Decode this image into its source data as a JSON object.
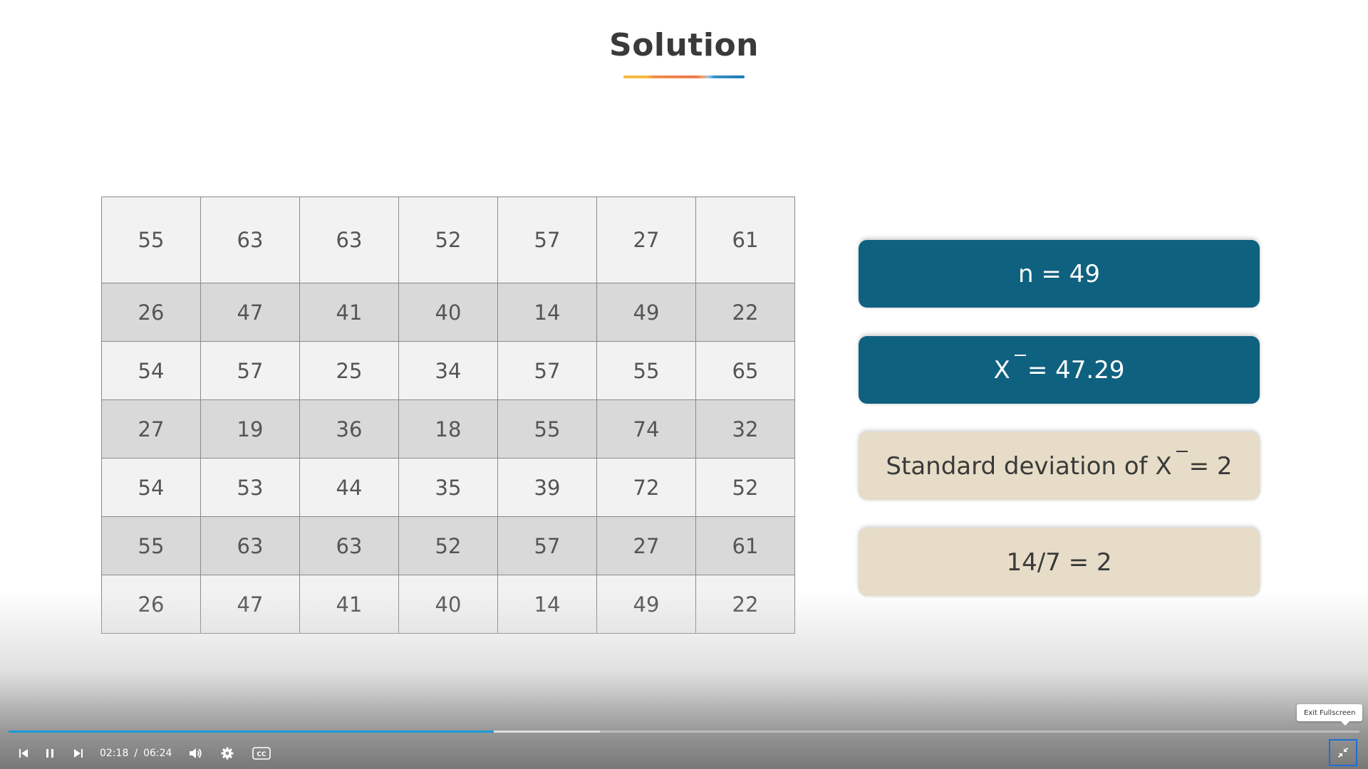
{
  "slide": {
    "title": "Solution",
    "table": [
      [
        "55",
        "63",
        "63",
        "52",
        "57",
        "27",
        "61"
      ],
      [
        "26",
        "47",
        "41",
        "40",
        "14",
        "49",
        "22"
      ],
      [
        "54",
        "57",
        "25",
        "34",
        "57",
        "55",
        "65"
      ],
      [
        "27",
        "19",
        "36",
        "18",
        "55",
        "74",
        "32"
      ],
      [
        "54",
        "53",
        "44",
        "35",
        "39",
        "72",
        "52"
      ],
      [
        "55",
        "63",
        "63",
        "52",
        "57",
        "27",
        "61"
      ],
      [
        "26",
        "47",
        "41",
        "40",
        "14",
        "49",
        "22"
      ]
    ],
    "boxes": {
      "n": "n = 49",
      "mean_symbol": "X",
      "mean_rest": "= 47.29",
      "sd_prefix": "Standard deviation of X",
      "sd_rest": "= 2",
      "ratio": "14/7 = 2"
    },
    "colors": {
      "blue_box": "#0f6180",
      "beige_box": "#e6dcc7",
      "row_light": "#f2f2f2",
      "row_dark": "#d9d9d9"
    }
  },
  "player": {
    "current_time": "02:18",
    "separator": "/",
    "duration": "06:24",
    "progress_played_fraction": 0.359,
    "progress_buffered_fraction": 0.4375,
    "tooltip": "Exit Fullscreen",
    "accent_color": "#1a9bd7",
    "icons": {
      "previous": "skip-previous-icon",
      "pause": "pause-icon",
      "next": "skip-next-icon",
      "volume": "volume-icon",
      "settings": "gear-icon",
      "captions": "closed-captions-icon",
      "exit_fullscreen": "exit-fullscreen-icon"
    },
    "captions_label": "CC"
  }
}
